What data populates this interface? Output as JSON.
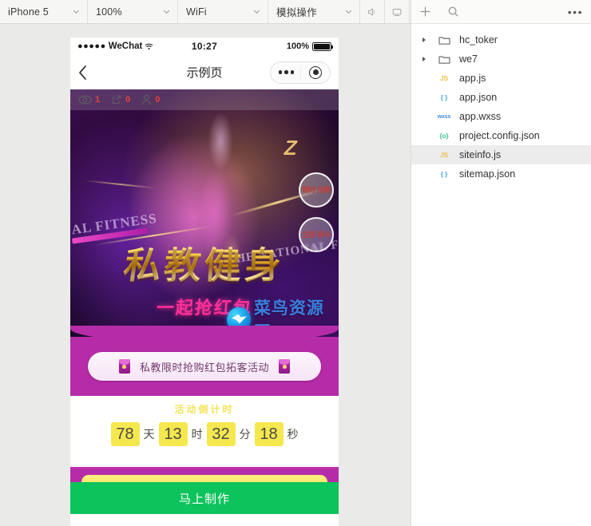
{
  "simulator": {
    "toolbar": {
      "device": "iPhone 5",
      "zoom": "100%",
      "network": "WiFi",
      "mode": "模拟操作",
      "volume_icon": "speaker-icon",
      "screen_icon": "monitor-icon"
    },
    "status_bar": {
      "signal_dots": "●●●●●",
      "carrier": "WeChat",
      "wifi_icon": "wifi-icon",
      "time": "10:27",
      "battery_percent": "100%"
    },
    "nav_bar": {
      "back_icon": "chevron-left-icon",
      "title": "示例页",
      "menu_icon": "more-dots-icon",
      "target_icon": "target-circle-icon"
    },
    "hero": {
      "stats": [
        {
          "icon": "eye-icon",
          "count": "1"
        },
        {
          "icon": "share-icon",
          "count": "0"
        },
        {
          "icon": "person-icon",
          "count": "0"
        }
      ],
      "fabs": [
        {
          "name": "floating-action-1",
          "text": "限时\n抢购"
        },
        {
          "name": "floating-action-2",
          "text": "立即\n参与"
        }
      ],
      "title_main": "私教健身",
      "title_sub": "一起抢红包",
      "english_left": "NAL FITNESS",
      "english_right": "THE NATIONAL FI",
      "z_glyph": "Z",
      "watermark_text": "菜鸟资源网"
    },
    "ribbon": {
      "text": "私教限时抢购红包拓客活动",
      "left_icon": "red-packet-icon",
      "right_icon": "red-packet-icon"
    },
    "countdown": {
      "label": "活动倒计时",
      "units": [
        {
          "value": "78",
          "unit": "天"
        },
        {
          "value": "13",
          "unit": "时"
        },
        {
          "value": "32",
          "unit": "分"
        },
        {
          "value": "18",
          "unit": "秒"
        }
      ]
    },
    "cta": {
      "label": "马上制作"
    }
  },
  "explorer": {
    "toolbar": {
      "add_icon": "plus-icon",
      "search_icon": "search-icon",
      "more_label": "•••"
    },
    "tree": [
      {
        "name": "hc_toker",
        "kind": "folder",
        "expandable": true,
        "indent": 0,
        "selected": false,
        "tag": ""
      },
      {
        "name": "we7",
        "kind": "folder",
        "expandable": true,
        "indent": 0,
        "selected": false,
        "tag": ""
      },
      {
        "name": "app.js",
        "kind": "js",
        "expandable": false,
        "indent": 1,
        "selected": false,
        "tag": "JS"
      },
      {
        "name": "app.json",
        "kind": "json",
        "expandable": false,
        "indent": 1,
        "selected": false,
        "tag": "{ }"
      },
      {
        "name": "app.wxss",
        "kind": "wxss",
        "expandable": false,
        "indent": 1,
        "selected": false,
        "tag": "wxss"
      },
      {
        "name": "project.config.json",
        "kind": "config",
        "expandable": false,
        "indent": 1,
        "selected": false,
        "tag": "{o}"
      },
      {
        "name": "siteinfo.js",
        "kind": "js",
        "expandable": false,
        "indent": 1,
        "selected": true,
        "tag": "JS"
      },
      {
        "name": "sitemap.json",
        "kind": "json",
        "expandable": false,
        "indent": 1,
        "selected": false,
        "tag": "{ }"
      }
    ]
  },
  "colors": {
    "magenta": "#b62ca8",
    "green": "#0cc35c",
    "yellow": "#f5e84f",
    "pink_title": "#ff2f9a",
    "stat_red": "#e8403a",
    "watermark_blue": "#3b7fe0",
    "app_bg": "#eaeae8"
  }
}
